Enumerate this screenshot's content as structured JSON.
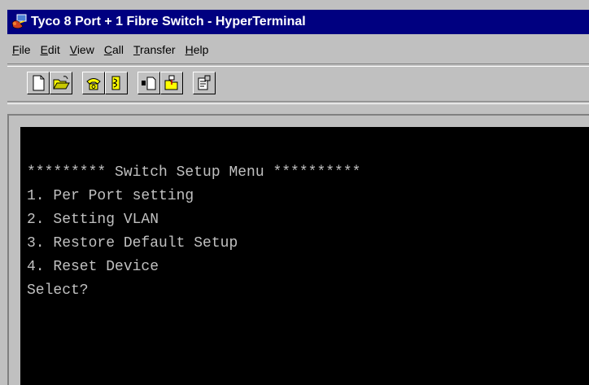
{
  "window": {
    "title": "Tyco 8 Port + 1 Fibre Switch - HyperTerminal",
    "app_icon": "hyperterminal-icon"
  },
  "menu": [
    {
      "accel": "F",
      "rest": "ile"
    },
    {
      "accel": "E",
      "rest": "dit"
    },
    {
      "accel": "V",
      "rest": "iew"
    },
    {
      "accel": "C",
      "rest": "all"
    },
    {
      "accel": "T",
      "rest": "ransfer"
    },
    {
      "accel": "H",
      "rest": "elp"
    }
  ],
  "toolbar": {
    "buttons": [
      "new-icon",
      "open-icon",
      "connect-icon",
      "disconnect-icon",
      "send-icon",
      "receive-icon",
      "properties-icon"
    ]
  },
  "terminal": {
    "lines": [
      "********* Switch Setup Menu **********",
      "1. Per Port setting",
      "2. Setting VLAN",
      "3. Restore Default Setup",
      "4. Reset Device",
      "Select?"
    ],
    "colors": {
      "background": "#000000",
      "text": "#c0c0c0"
    }
  }
}
